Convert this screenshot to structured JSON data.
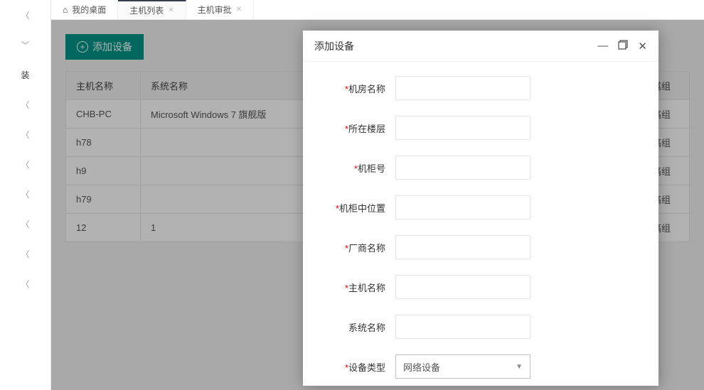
{
  "sidenav": {
    "items": [
      {
        "type": "chevron-left"
      },
      {
        "type": "chevron-down"
      },
      {
        "type": "text",
        "label": "装"
      },
      {
        "type": "chevron-left"
      },
      {
        "type": "chevron-left"
      },
      {
        "type": "chevron-left"
      },
      {
        "type": "chevron-left"
      },
      {
        "type": "chevron-left"
      },
      {
        "type": "chevron-left"
      },
      {
        "type": "chevron-left"
      }
    ]
  },
  "tabs": [
    {
      "label": "我的桌面",
      "closable": false,
      "home": true
    },
    {
      "label": "主机列表",
      "closable": true,
      "active": true
    },
    {
      "label": "主机审批",
      "closable": true
    }
  ],
  "toolbar": {
    "add_device_label": "添加设备"
  },
  "table": {
    "headers": {
      "host_name": "主机名称",
      "system_name": "系统名称",
      "group": "所属组"
    },
    "rows": [
      {
        "host_name": "CHB-PC",
        "system_name": "Microsoft Windows 7 旗舰版",
        "group": "胸痛组"
      },
      {
        "host_name": "h78",
        "system_name": "",
        "group": "胸痛组"
      },
      {
        "host_name": "h9",
        "system_name": "",
        "group": "胸痛组"
      },
      {
        "host_name": "h79",
        "system_name": "",
        "group": "胸痛组"
      },
      {
        "host_name": "12",
        "system_name": "1",
        "group": "胸痛组"
      }
    ]
  },
  "modal": {
    "title": "添加设备",
    "fields": {
      "room_name": {
        "label": "机房名称",
        "required": true,
        "value": ""
      },
      "floor": {
        "label": "所在楼层",
        "required": true,
        "value": ""
      },
      "cabinet_no": {
        "label": "机柜号",
        "required": true,
        "value": ""
      },
      "cabinet_pos": {
        "label": "机柜中位置",
        "required": true,
        "value": ""
      },
      "vendor": {
        "label": "厂商名称",
        "required": true,
        "value": ""
      },
      "host_name": {
        "label": "主机名称",
        "required": true,
        "value": ""
      },
      "system_name": {
        "label": "系统名称",
        "required": false,
        "value": ""
      },
      "device_type": {
        "label": "设备类型",
        "required": true,
        "value": "网络设备"
      }
    }
  }
}
